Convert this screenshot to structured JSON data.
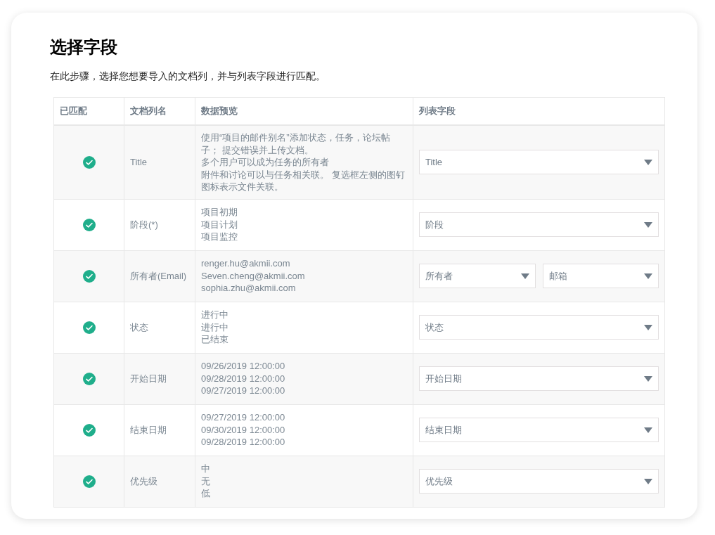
{
  "title": "选择字段",
  "description": "在此步骤，选择您想要导入的文档列，并与列表字段进行匹配。",
  "table": {
    "columns": [
      "已匹配",
      "文档列名",
      "数据预览",
      "列表字段"
    ],
    "rows": [
      {
        "matched": true,
        "name": "Title",
        "preview": [
          "使用“项目的邮件别名”添加状态，任务，论坛帖子； 提交错误并上传文档。",
          "多个用户可以成为任务的所有者",
          "附件和讨论可以与任务相关联。 复选框左侧的图钉图标表示文件关联。"
        ],
        "fields": [
          "Title"
        ]
      },
      {
        "matched": true,
        "name": "阶段(*)",
        "preview": [
          "项目初期",
          "项目计划",
          "项目监控"
        ],
        "fields": [
          "阶段"
        ]
      },
      {
        "matched": true,
        "name": "所有者(Email)",
        "preview": [
          "renger.hu@akmii.com",
          "Seven.cheng@akmii.com",
          "sophia.zhu@akmii.com"
        ],
        "fields": [
          "所有者",
          "邮箱"
        ]
      },
      {
        "matched": true,
        "name": "状态",
        "preview": [
          "进行中",
          "进行中",
          "已结束"
        ],
        "fields": [
          "状态"
        ]
      },
      {
        "matched": true,
        "name": "开始日期",
        "preview": [
          "09/26/2019 12:00:00",
          "09/28/2019 12:00:00",
          "09/27/2019 12:00:00"
        ],
        "fields": [
          "开始日期"
        ]
      },
      {
        "matched": true,
        "name": "结束日期",
        "preview": [
          "09/27/2019 12:00:00",
          "09/30/2019 12:00:00",
          "09/28/2019 12:00:00"
        ],
        "fields": [
          "结束日期"
        ]
      },
      {
        "matched": true,
        "name": "优先级",
        "preview": [
          "中",
          "无",
          "低"
        ],
        "fields": [
          "优先级"
        ]
      }
    ]
  }
}
